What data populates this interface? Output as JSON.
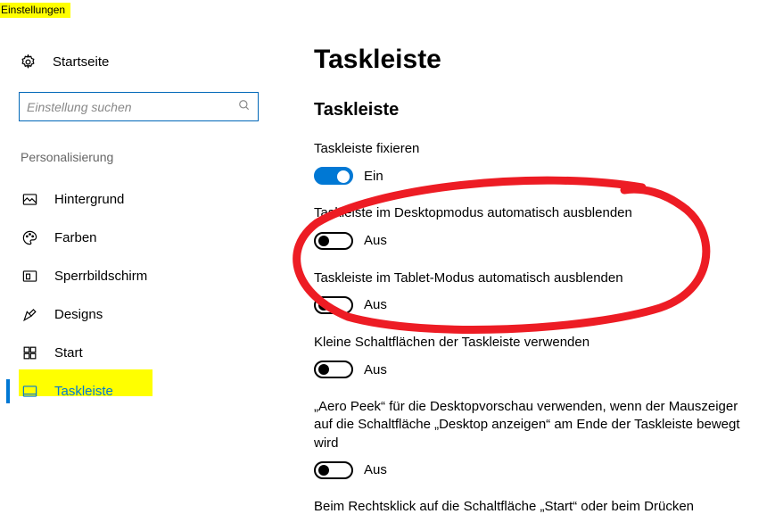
{
  "app": {
    "title": "Einstellungen"
  },
  "sidebar": {
    "home": "Startseite",
    "search_placeholder": "Einstellung suchen",
    "section": "Personalisierung",
    "items": [
      {
        "label": "Hintergrund"
      },
      {
        "label": "Farben"
      },
      {
        "label": "Sperrbildschirm"
      },
      {
        "label": "Designs"
      },
      {
        "label": "Start"
      },
      {
        "label": "Taskleiste"
      }
    ]
  },
  "main": {
    "title": "Taskleiste",
    "subhead": "Taskleiste",
    "settings": [
      {
        "label": "Taskleiste fixieren",
        "state": "Ein"
      },
      {
        "label": "Taskleiste im Desktopmodus automatisch ausblenden",
        "state": "Aus"
      },
      {
        "label": "Taskleiste im Tablet-Modus automatisch ausblenden",
        "state": "Aus"
      },
      {
        "label": "Kleine Schaltflächen der Taskleiste verwenden",
        "state": "Aus"
      },
      {
        "label": "„Aero Peek“ für die Desktopvorschau verwenden, wenn der Mauszeiger auf die Schaltfläche „Desktop anzeigen“ am Ende der Taskleiste bewegt wird",
        "state": "Aus"
      }
    ],
    "cutoff_text": "Beim Rechtsklick auf die Schaltfläche „Start“ oder beim Drücken"
  }
}
